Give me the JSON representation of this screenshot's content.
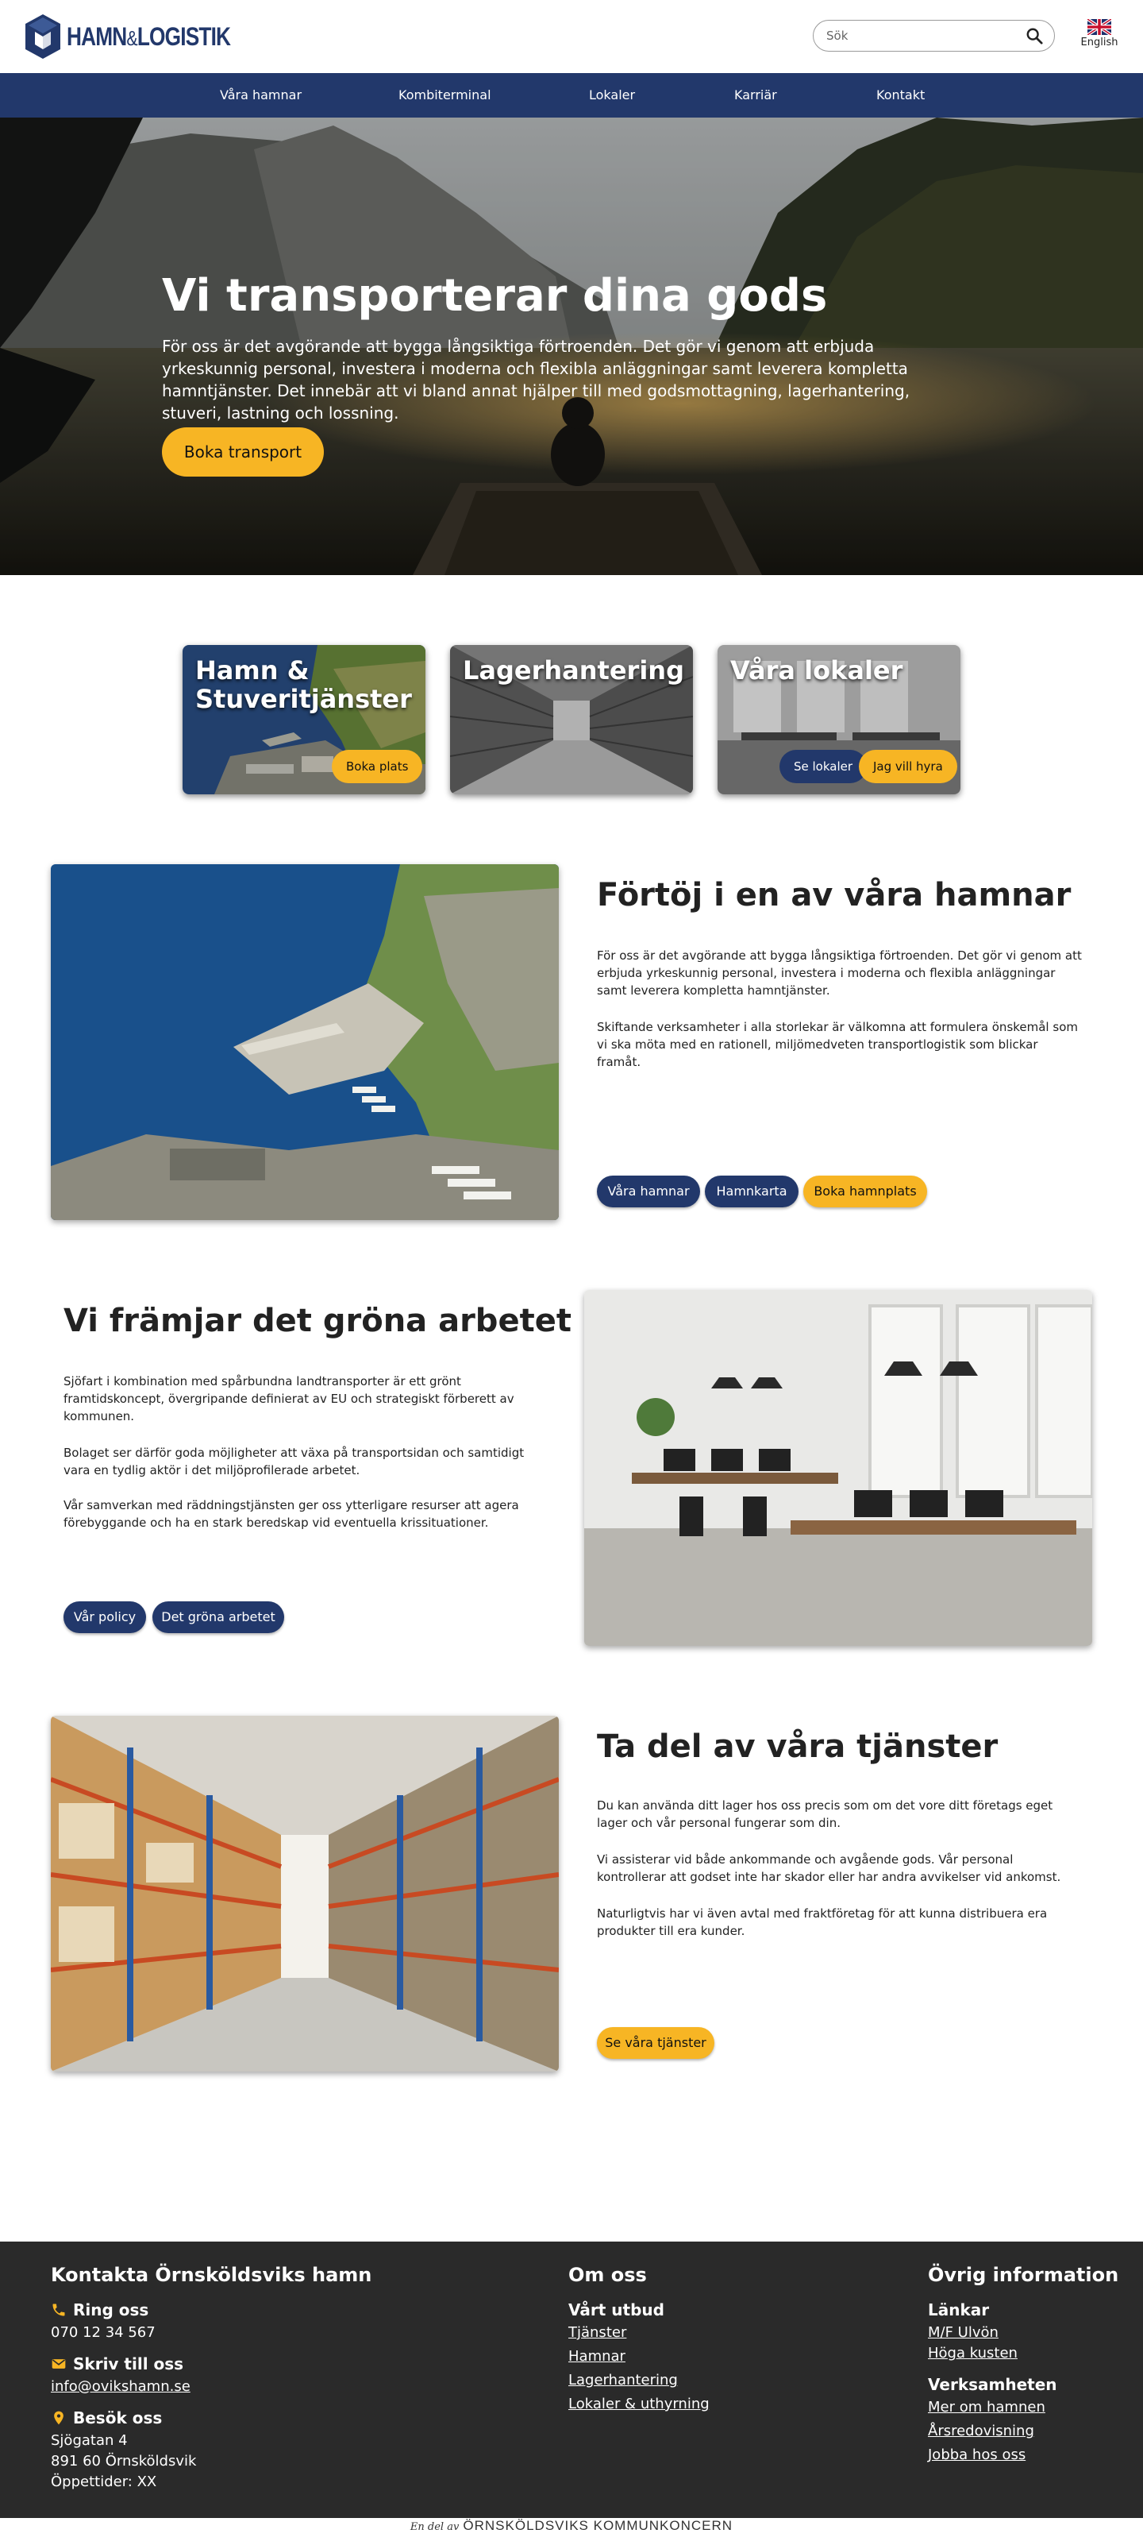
{
  "header": {
    "logo_text_1": "HAMN",
    "logo_amp": "&",
    "logo_text_2": "LOGISTIK",
    "search_placeholder": "Sök",
    "search_icon": "search-icon",
    "language_label": "English",
    "language_icon": "uk-flag-icon"
  },
  "nav": {
    "items": [
      "Våra hamnar",
      "Kombiterminal",
      "Lokaler",
      "Karriär",
      "Kontakt"
    ]
  },
  "hero": {
    "title": "Vi transporterar dina gods",
    "text": "För oss är det avgörande att bygga långsiktiga förtroenden. Det gör vi genom att erbjuda yrkeskunnig personal, investera i moderna och flexibla anläggningar samt leverera kompletta hamntjänster. Det innebär att vi bland annat hjälper till med godsmottagning, lagerhantering, stuveri, lastning och lossning.",
    "button": "Boka transport"
  },
  "cards": [
    {
      "title": "Hamn & Stuveritjänster",
      "buttons": [
        "Boka plats"
      ]
    },
    {
      "title": "Lagerhantering",
      "buttons": []
    },
    {
      "title": "Våra lokaler",
      "buttons": [
        "Se lokaler",
        "Jag vill hyra"
      ]
    }
  ],
  "section1": {
    "title": "Förtöj i en av våra hamnar",
    "paragraphs": [
      "För oss är det avgörande att bygga långsiktiga förtroenden. Det gör vi genom att erbjuda yrkeskunnig personal, investera i moderna och flexibla anläggningar samt leverera kompletta hamntjänster.",
      "Skiftande verksamheter i alla storlekar är välkomna att formulera önskemål som vi ska möta med en rationell, miljömedveten transportlogistik som blickar framåt."
    ],
    "buttons": [
      "Våra hamnar",
      "Hamnkarta",
      "Boka hamnplats"
    ]
  },
  "section2": {
    "title": "Vi främjar det gröna arbetet",
    "paragraphs": [
      "Sjöfart i kombination med spårbundna landtransporter är ett grönt framtidskoncept, övergripande definierat av EU och strategiskt förberett av kommunen.",
      "Bolaget ser därför goda möjligheter att växa på transportsidan och samtidigt vara en tydlig aktör i det miljöprofilerade arbetet.",
      "Vår samverkan med räddningstjänsten ger oss ytterligare resurser att agera förebyggande och ha en stark beredskap vid eventuella krissituationer."
    ],
    "buttons": [
      "Vår policy",
      "Det gröna arbetet"
    ]
  },
  "section3": {
    "title": "Ta del av våra tjänster",
    "paragraphs": [
      "Du kan använda ditt lager hos oss precis som om det vore ditt företags eget lager och vår personal fungerar som din.",
      "Vi assisterar vid både ankommande och avgående gods. Vår personal kontrollerar att godset inte har skador eller har andra avvikelser vid ankomst.",
      "Naturligtvis har vi även avtal med fraktföretag för att kunna distribuera era produkter till era kunder."
    ],
    "buttons": [
      "Se våra tjänster"
    ]
  },
  "footer": {
    "contact": {
      "heading": "Kontakta Örnsköldsviks hamn",
      "call_label": "Ring oss",
      "phone": "070 12 34 567",
      "write_label": "Skriv till oss",
      "email": "info@ovikshamn.se",
      "visit_label": "Besök oss",
      "address_1": "Sjögatan 4",
      "address_2": "891 60 Örnsköldsvik",
      "hours": "Öppettider: XX"
    },
    "about": {
      "heading": "Om oss",
      "subheading": "Vårt utbud",
      "links": [
        "Tjänster",
        "Hamnar",
        "Lagerhantering",
        "Lokaler & uthyrning"
      ]
    },
    "other": {
      "heading": "Övrig information",
      "links_heading": "Länkar",
      "links": [
        "M/F Ulvön",
        "Höga kusten"
      ],
      "business_heading": "Verksamheten",
      "business_links": [
        "Mer om hamnen",
        "Årsredovisning",
        "Jobba hos oss"
      ]
    }
  },
  "bottom_bar": {
    "prefix": "En del av",
    "name": "ÖRNSKÖLDSVIKS KOMMUNKONCERN"
  },
  "colors": {
    "brand_navy": "#22386b",
    "accent_yellow": "#f7b524",
    "footer_bg": "#2a2a2a"
  }
}
